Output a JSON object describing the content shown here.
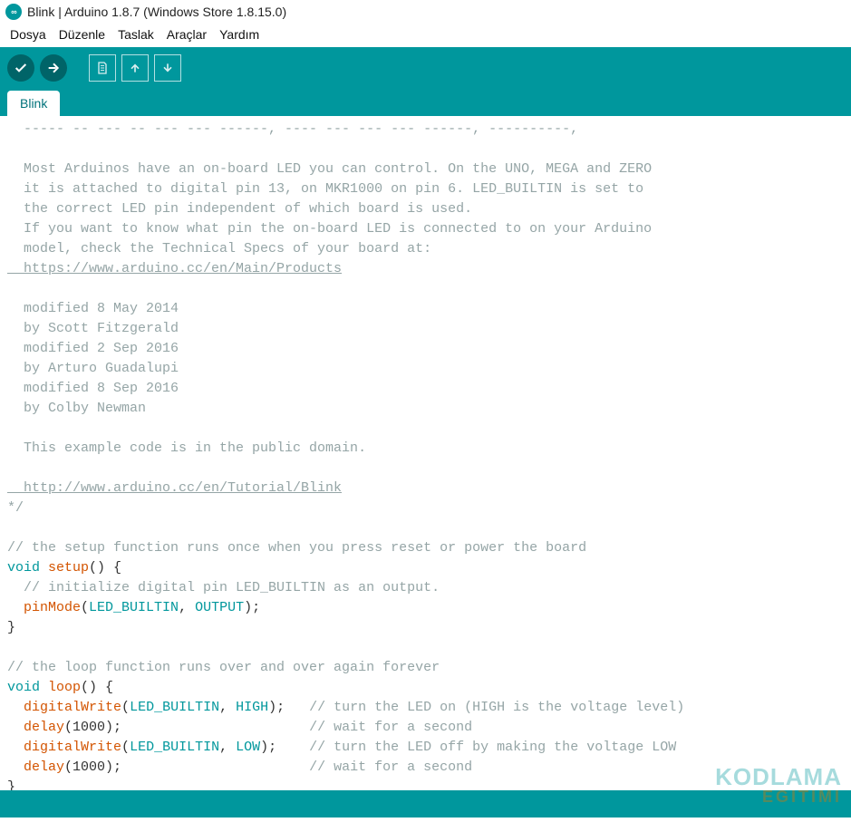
{
  "window": {
    "title": "Blink | Arduino 1.8.7 (Windows Store 1.8.15.0)"
  },
  "menu": {
    "items": [
      "Dosya",
      "Düzenle",
      "Taslak",
      "Araçlar",
      "Yardım"
    ]
  },
  "toolbar": {
    "verify": "verify",
    "upload": "upload",
    "new": "new",
    "open": "open",
    "save": "save"
  },
  "tabs": {
    "active": "Blink"
  },
  "code": {
    "lines": [
      {
        "t": "comment",
        "text": "  ----- -- --- -- --- --- ------, ---- --- --- --- ------, ----------,"
      },
      {
        "t": "blank",
        "text": ""
      },
      {
        "t": "comment",
        "text": "  Most Arduinos have an on-board LED you can control. On the UNO, MEGA and ZERO"
      },
      {
        "t": "comment",
        "text": "  it is attached to digital pin 13, on MKR1000 on pin 6. LED_BUILTIN is set to"
      },
      {
        "t": "comment",
        "text": "  the correct LED pin independent of which board is used."
      },
      {
        "t": "comment",
        "text": "  If you want to know what pin the on-board LED is connected to on your Arduino"
      },
      {
        "t": "comment",
        "text": "  model, check the Technical Specs of your board at:"
      },
      {
        "t": "link",
        "text": "  https://www.arduino.cc/en/Main/Products"
      },
      {
        "t": "blank",
        "text": ""
      },
      {
        "t": "comment",
        "text": "  modified 8 May 2014"
      },
      {
        "t": "comment",
        "text": "  by Scott Fitzgerald"
      },
      {
        "t": "comment",
        "text": "  modified 2 Sep 2016"
      },
      {
        "t": "comment",
        "text": "  by Arturo Guadalupi"
      },
      {
        "t": "comment",
        "text": "  modified 8 Sep 2016"
      },
      {
        "t": "comment",
        "text": "  by Colby Newman"
      },
      {
        "t": "blank",
        "text": ""
      },
      {
        "t": "comment",
        "text": "  This example code is in the public domain."
      },
      {
        "t": "blank",
        "text": ""
      },
      {
        "t": "link",
        "text": "  http://www.arduino.cc/en/Tutorial/Blink"
      },
      {
        "t": "comment",
        "text": "*/"
      },
      {
        "t": "blank",
        "text": ""
      },
      {
        "t": "comment",
        "text": "// the setup function runs once when you press reset or power the board"
      },
      {
        "t": "code",
        "text": "void setup() {",
        "tokens": [
          [
            "type",
            "void"
          ],
          [
            "plain",
            " "
          ],
          [
            "func",
            "setup"
          ],
          [
            "plain",
            "() {"
          ]
        ]
      },
      {
        "t": "comment",
        "text": "  // initialize digital pin LED_BUILTIN as an output."
      },
      {
        "t": "code",
        "text": "  pinMode(LED_BUILTIN, OUTPUT);",
        "tokens": [
          [
            "plain",
            "  "
          ],
          [
            "func",
            "pinMode"
          ],
          [
            "plain",
            "("
          ],
          [
            "const",
            "LED_BUILTIN"
          ],
          [
            "plain",
            ", "
          ],
          [
            "const",
            "OUTPUT"
          ],
          [
            "plain",
            ");"
          ]
        ]
      },
      {
        "t": "plain",
        "text": "}"
      },
      {
        "t": "blank",
        "text": ""
      },
      {
        "t": "comment",
        "text": "// the loop function runs over and over again forever"
      },
      {
        "t": "code",
        "text": "void loop() {",
        "tokens": [
          [
            "type",
            "void"
          ],
          [
            "plain",
            " "
          ],
          [
            "func",
            "loop"
          ],
          [
            "plain",
            "() {"
          ]
        ]
      },
      {
        "t": "code",
        "text": "  digitalWrite(LED_BUILTIN, HIGH);   // turn the LED on (HIGH is the voltage level)",
        "tokens": [
          [
            "plain",
            "  "
          ],
          [
            "func",
            "digitalWrite"
          ],
          [
            "plain",
            "("
          ],
          [
            "const",
            "LED_BUILTIN"
          ],
          [
            "plain",
            ", "
          ],
          [
            "const",
            "HIGH"
          ],
          [
            "plain",
            ");   "
          ],
          [
            "comment",
            "// turn the LED on (HIGH is the voltage level)"
          ]
        ]
      },
      {
        "t": "code",
        "text": "  delay(1000);                       // wait for a second",
        "tokens": [
          [
            "plain",
            "  "
          ],
          [
            "func",
            "delay"
          ],
          [
            "plain",
            "(1000);                       "
          ],
          [
            "comment",
            "// wait for a second"
          ]
        ]
      },
      {
        "t": "code",
        "text": "  digitalWrite(LED_BUILTIN, LOW);    // turn the LED off by making the voltage LOW",
        "tokens": [
          [
            "plain",
            "  "
          ],
          [
            "func",
            "digitalWrite"
          ],
          [
            "plain",
            "("
          ],
          [
            "const",
            "LED_BUILTIN"
          ],
          [
            "plain",
            ", "
          ],
          [
            "const",
            "LOW"
          ],
          [
            "plain",
            ");    "
          ],
          [
            "comment",
            "// turn the LED off by making the voltage LOW"
          ]
        ]
      },
      {
        "t": "code",
        "text": "  delay(1000);                       // wait for a second",
        "tokens": [
          [
            "plain",
            "  "
          ],
          [
            "func",
            "delay"
          ],
          [
            "plain",
            "(1000);                       "
          ],
          [
            "comment",
            "// wait for a second"
          ]
        ]
      },
      {
        "t": "plain",
        "text": "}"
      }
    ]
  },
  "watermark": {
    "line1": "KODLAMA",
    "line2": "EGITIMI"
  }
}
